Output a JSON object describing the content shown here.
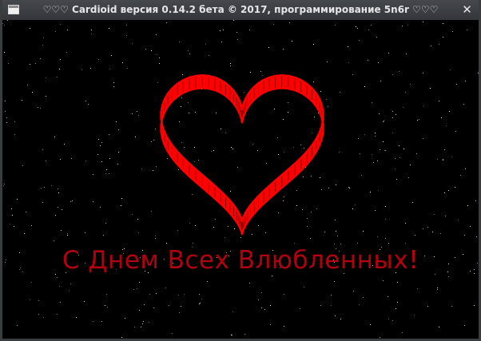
{
  "window": {
    "title": "♡♡♡ Cardioid версия 0.14.2 бета © 2017, программирование 5n6r ♡♡♡",
    "close_glyph": "✕"
  },
  "scene": {
    "greeting": "С Днем Всех Влюбленных!",
    "heart_color": "#ff0000",
    "heart_dark_color": "#8a0000",
    "text_color": "#b3000f",
    "background_color": "#000000",
    "star_color": "#ffffff"
  }
}
